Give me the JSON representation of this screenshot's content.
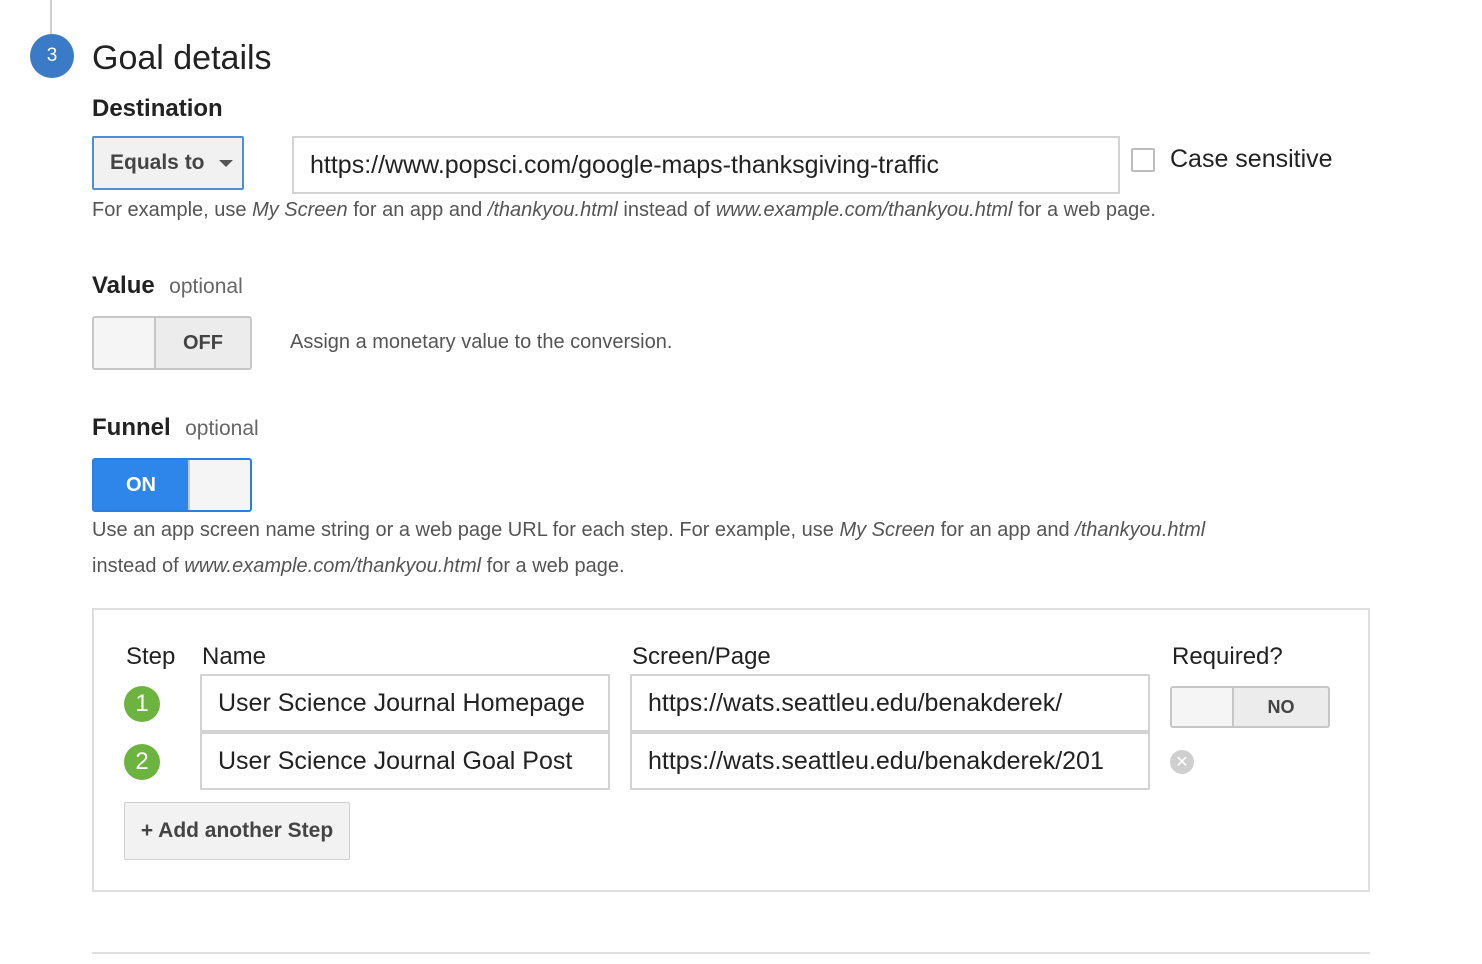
{
  "section": {
    "step_number": "3",
    "title": "Goal details"
  },
  "destination": {
    "label": "Destination",
    "match_type": "Equals to",
    "value": "https://www.popsci.com/google-maps-thanksgiving-traffic",
    "case_sensitive_label": "Case sensitive",
    "case_sensitive_checked": false,
    "help": {
      "p1": "For example, use ",
      "i1": "My Screen",
      "p2": " for an app and ",
      "i2": "/thankyou.html",
      "p3": " instead of ",
      "i3": "www.example.com/thankyou.html",
      "p4": " for a web page."
    }
  },
  "value": {
    "label": "Value",
    "optional": "optional",
    "toggle_state": "OFF",
    "description": "Assign a monetary value to the conversion."
  },
  "funnel": {
    "label": "Funnel",
    "optional": "optional",
    "toggle_state": "ON",
    "help": {
      "p1": "Use an app screen name string or a web page URL for each step. For example, use ",
      "i1": "My Screen",
      "p2": " for an app and ",
      "i2": "/thankyou.html",
      "p3": "instead of ",
      "i3": "www.example.com/thankyou.html",
      "p4": " for a web page."
    },
    "columns": {
      "step": "Step",
      "name": "Name",
      "screen": "Screen/Page",
      "required": "Required?"
    },
    "steps": [
      {
        "num": "1",
        "name": "User Science Journal Homepage",
        "screen": "https://wats.seattleu.edu/benakderek/",
        "required": "NO"
      },
      {
        "num": "2",
        "name": "User Science Journal Goal Post",
        "screen": "https://wats.seattleu.edu/benakderek/201"
      }
    ],
    "add_step_label": "+ Add another Step",
    "remove_icon": "close-circle-icon"
  },
  "colors": {
    "accent_blue": "#2f86ea",
    "step_green": "#6cb33f",
    "badge_blue": "#3a7ac6"
  }
}
